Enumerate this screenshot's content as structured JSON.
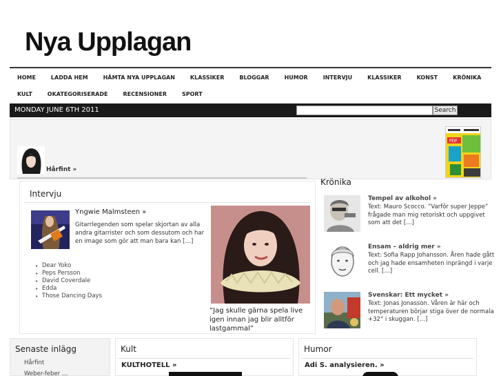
{
  "site": {
    "title": "Nya Upplagan"
  },
  "nav": {
    "row1": [
      "HOME",
      "LADDA HEM",
      "HÄMTA NYA UPPLAGAN",
      "KLASSIKER",
      "BLOGGAR",
      "HUMOR",
      "INTERVJU",
      "KLASSIKER",
      "KONST",
      "KRÖNIKA"
    ],
    "row2": [
      "KULT",
      "OKATEGORISERADE",
      "RECENSIONER",
      "SPORT"
    ]
  },
  "datebar": {
    "date": "MONDAY JUNE 6TH 2011",
    "search_button": "Search",
    "search_value": ""
  },
  "featured": {
    "link": "Hårfint »",
    "magazine_badge": "PDF"
  },
  "intervju": {
    "title": "Intervju",
    "main_post": {
      "title": "Yngwie Malmsteen »",
      "excerpt": "Gitarrlegenden som spelar skjortan av alla andra gitarrister och som dessutom och har en image som gör att man bara kan […]"
    },
    "list": [
      "Dear Yoko",
      "Peps Persson",
      "David Coverdale",
      "Edda",
      "Those Dancing Days"
    ],
    "photo_caption": "”Jag skulle gärna spela live igen innan jag blir alltför lastgammal”"
  },
  "kronika": {
    "title": "Krönika",
    "items": [
      {
        "title": "Tempel av alkohol »",
        "excerpt": "Text: Mauro Scocco. ”Varför super Jeppe” frågade man mig retoriskt och uppgivet som att det […]"
      },
      {
        "title": "Ensam – aldrig mer »",
        "excerpt": "Text: Sofia Rapp Johansson. Åren hade gått och jag hade ensamheten inpräng­d i varje cell. […]"
      },
      {
        "title": "Svenskar: Ett mycket »",
        "excerpt": "Text: Jonas Jonasson. Våren är här och temperaturen börjar stiga över de normala +32° i skuggan. […]"
      }
    ]
  },
  "senaste": {
    "title": "Senaste inlägg",
    "items": [
      "Hårfint",
      "Weber-feber …"
    ]
  },
  "kult": {
    "title": "Kult",
    "post": "KULTHOTELL »"
  },
  "humor": {
    "title": "Humor",
    "post": "Adi S. analysieren. »"
  },
  "colors": {
    "datebar_bg": "#1a1a1a",
    "magazine_bg": "#f1d51c",
    "nav_border": "#333333"
  }
}
